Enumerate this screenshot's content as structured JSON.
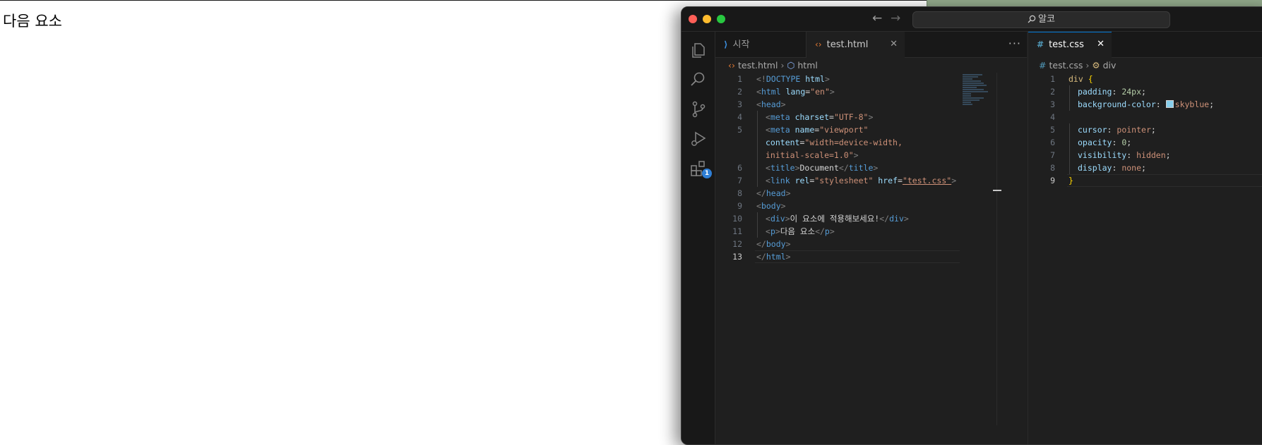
{
  "browser": {
    "page_text": "다음 요소"
  },
  "window": {
    "search_placeholder": "알코",
    "activity_badge": "1"
  },
  "left_editor": {
    "tabs": [
      {
        "label": "시작",
        "icon": "vscode-logo-icon"
      },
      {
        "label": "test.html",
        "icon": "html-file-icon",
        "active": true
      }
    ],
    "breadcrumb": [
      "test.html",
      "html"
    ],
    "active_line": 13
  },
  "right_editor": {
    "tab_label": "test.css",
    "breadcrumb": [
      "test.css",
      "div"
    ],
    "active_line": 9
  },
  "colors": {
    "accent": "#0078d4",
    "swatch_skyblue": "#87ceeb",
    "editor_bg": "#1f1f1f"
  },
  "html_code": [
    {
      "n": "1",
      "parts": [
        [
          "t-br",
          "<!"
        ],
        [
          "t-tag",
          "DOCTYPE "
        ],
        [
          "t-attr",
          "html"
        ],
        [
          "t-br",
          ">"
        ]
      ]
    },
    {
      "n": "2",
      "parts": [
        [
          "t-br",
          "<"
        ],
        [
          "t-tag",
          "html "
        ],
        [
          "t-attr",
          "lang"
        ],
        [
          "t-punc",
          "="
        ],
        [
          "t-str",
          "\"en\""
        ],
        [
          "t-br",
          ">"
        ]
      ]
    },
    {
      "n": "3",
      "parts": [
        [
          "t-br",
          "<"
        ],
        [
          "t-tag",
          "head"
        ],
        [
          "t-br",
          ">"
        ]
      ]
    },
    {
      "n": "4",
      "indent": 1,
      "parts": [
        [
          "t-br",
          "<"
        ],
        [
          "t-tag",
          "meta "
        ],
        [
          "t-attr",
          "charset"
        ],
        [
          "t-punc",
          "="
        ],
        [
          "t-str",
          "\"UTF-8\""
        ],
        [
          "t-br",
          ">"
        ]
      ]
    },
    {
      "n": "5",
      "indent": 1,
      "parts": [
        [
          "t-br",
          "<"
        ],
        [
          "t-tag",
          "meta "
        ],
        [
          "t-attr",
          "name"
        ],
        [
          "t-punc",
          "="
        ],
        [
          "t-str",
          "\"viewport\""
        ]
      ]
    },
    {
      "n": "",
      "indent": 1,
      "parts": [
        [
          "t-attr",
          "content"
        ],
        [
          "t-punc",
          "="
        ],
        [
          "t-str",
          "\"width=device-width,"
        ]
      ]
    },
    {
      "n": "",
      "indent": 1,
      "parts": [
        [
          "t-str",
          "initial-scale=1.0\""
        ],
        [
          "t-br",
          ">"
        ]
      ]
    },
    {
      "n": "6",
      "indent": 1,
      "parts": [
        [
          "t-br",
          "<"
        ],
        [
          "t-tag",
          "title"
        ],
        [
          "t-br",
          ">"
        ],
        [
          "t-text",
          "Document"
        ],
        [
          "t-br",
          "</"
        ],
        [
          "t-tag",
          "title"
        ],
        [
          "t-br",
          ">"
        ]
      ]
    },
    {
      "n": "7",
      "indent": 1,
      "parts": [
        [
          "t-br",
          "<"
        ],
        [
          "t-tag",
          "link "
        ],
        [
          "t-attr",
          "rel"
        ],
        [
          "t-punc",
          "="
        ],
        [
          "t-str",
          "\"stylesheet\" "
        ],
        [
          "t-attr",
          "href"
        ],
        [
          "t-punc",
          "="
        ],
        [
          "t-str",
          "\"test.css\""
        ],
        [
          "t-br",
          ">"
        ]
      ]
    },
    {
      "n": "8",
      "parts": [
        [
          "t-br",
          "</"
        ],
        [
          "t-tag",
          "head"
        ],
        [
          "t-br",
          ">"
        ]
      ]
    },
    {
      "n": "9",
      "parts": [
        [
          "t-br",
          "<"
        ],
        [
          "t-tag",
          "body"
        ],
        [
          "t-br",
          ">"
        ]
      ]
    },
    {
      "n": "10",
      "indent": 1,
      "parts": [
        [
          "t-br",
          "<"
        ],
        [
          "t-tag",
          "div"
        ],
        [
          "t-br",
          ">"
        ],
        [
          "t-text",
          "이 요소에 적용해보세요!"
        ],
        [
          "t-br",
          "</"
        ],
        [
          "t-tag",
          "div"
        ],
        [
          "t-br",
          ">"
        ]
      ]
    },
    {
      "n": "11",
      "indent": 1,
      "parts": [
        [
          "t-br",
          "<"
        ],
        [
          "t-tag",
          "p"
        ],
        [
          "t-br",
          ">"
        ],
        [
          "t-text",
          "다음 요소"
        ],
        [
          "t-br",
          "</"
        ],
        [
          "t-tag",
          "p"
        ],
        [
          "t-br",
          ">"
        ]
      ]
    },
    {
      "n": "12",
      "parts": [
        [
          "t-br",
          "</"
        ],
        [
          "t-tag",
          "body"
        ],
        [
          "t-br",
          ">"
        ]
      ]
    },
    {
      "n": "13",
      "parts": [
        [
          "t-br",
          "</"
        ],
        [
          "t-tag",
          "html"
        ],
        [
          "t-br",
          ">"
        ]
      ]
    }
  ],
  "css_code": [
    {
      "n": "1",
      "parts": [
        [
          "t-sel",
          "div "
        ],
        [
          "t-brace",
          "{"
        ]
      ]
    },
    {
      "n": "2",
      "indent": 1,
      "parts": [
        [
          "t-prop",
          "padding"
        ],
        [
          "t-punc",
          ": "
        ],
        [
          "t-num",
          "24px"
        ],
        [
          "t-punc",
          ";"
        ]
      ]
    },
    {
      "n": "3",
      "indent": 1,
      "swatch": true,
      "parts": [
        [
          "t-prop",
          "background-color"
        ],
        [
          "t-punc",
          ": "
        ],
        [
          "swatch",
          ""
        ],
        [
          "t-val",
          "skyblue"
        ],
        [
          "t-punc",
          ";"
        ]
      ]
    },
    {
      "n": "4",
      "parts": []
    },
    {
      "n": "5",
      "indent": 1,
      "parts": [
        [
          "t-prop",
          "cursor"
        ],
        [
          "t-punc",
          ": "
        ],
        [
          "t-val",
          "pointer"
        ],
        [
          "t-punc",
          ";"
        ]
      ]
    },
    {
      "n": "6",
      "indent": 1,
      "parts": [
        [
          "t-prop",
          "opacity"
        ],
        [
          "t-punc",
          ": "
        ],
        [
          "t-num",
          "0"
        ],
        [
          "t-punc",
          ";"
        ]
      ]
    },
    {
      "n": "7",
      "indent": 1,
      "parts": [
        [
          "t-prop",
          "visibility"
        ],
        [
          "t-punc",
          ": "
        ],
        [
          "t-val",
          "hidden"
        ],
        [
          "t-punc",
          ";"
        ]
      ]
    },
    {
      "n": "8",
      "indent": 1,
      "parts": [
        [
          "t-prop",
          "display"
        ],
        [
          "t-punc",
          ": "
        ],
        [
          "t-val",
          "none"
        ],
        [
          "t-punc",
          ";"
        ]
      ]
    },
    {
      "n": "9",
      "parts": [
        [
          "t-brace",
          "}"
        ]
      ]
    }
  ]
}
